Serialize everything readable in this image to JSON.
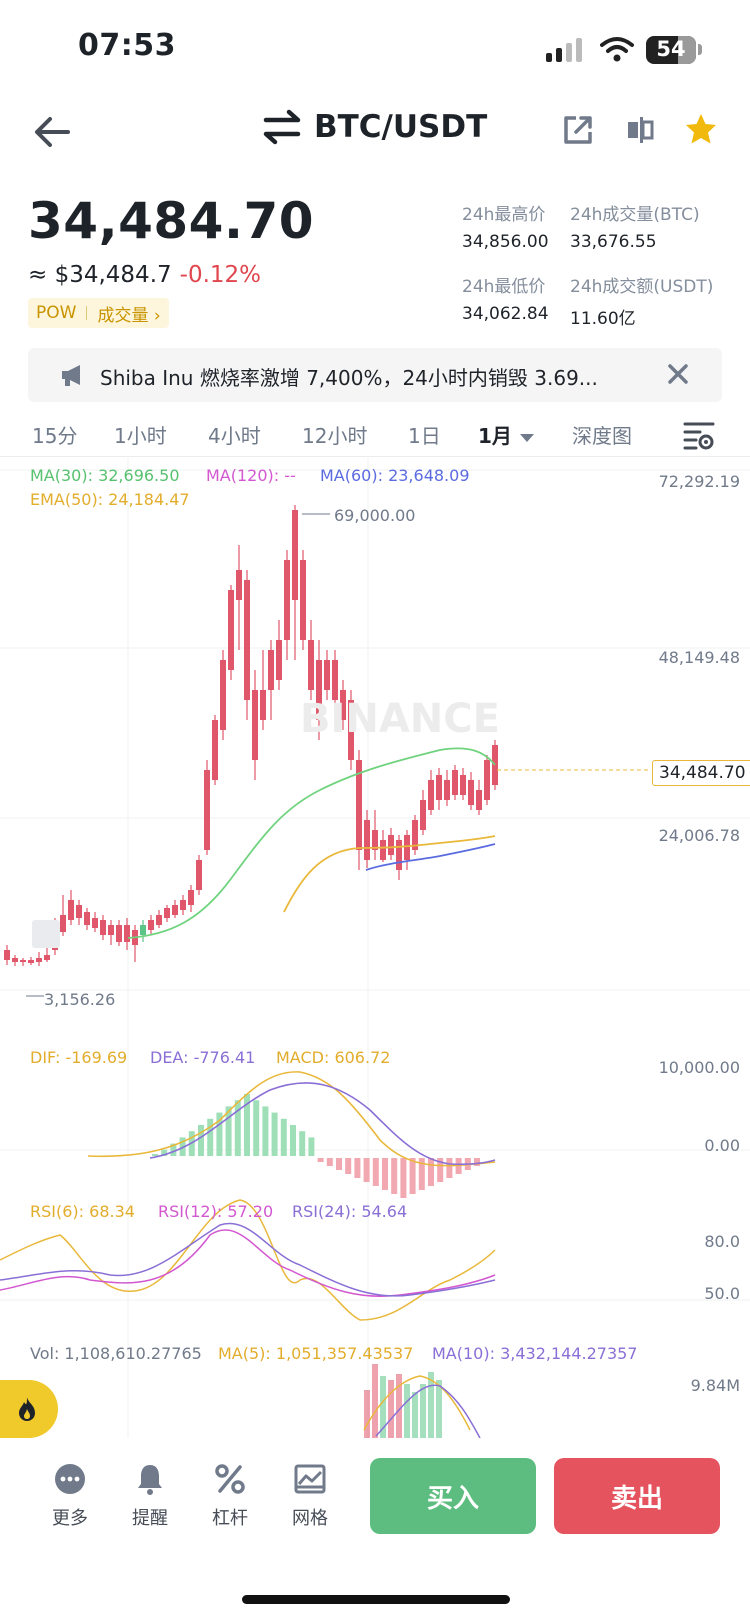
{
  "status_bar": {
    "time": "07:53",
    "battery": "54"
  },
  "header": {
    "title": "BTC/USDT"
  },
  "price": {
    "last": "34,484.70",
    "fiat": "≈ $34,484.7",
    "change": "-0.12%",
    "tag": "POW",
    "tag_link": "成交量 ›"
  },
  "stats": {
    "high_label": "24h最高价",
    "high_value": "34,856.00",
    "vol_btc_label": "24h成交量(BTC)",
    "vol_btc_value": "33,676.55",
    "low_label": "24h最低价",
    "low_value": "34,062.84",
    "vol_usdt_label": "24h成交额(USDT)",
    "vol_usdt_value": "11.60亿"
  },
  "news": {
    "text": "Shiba Inu 燃烧率激增 7,400%，24小时内销毁 3.69..."
  },
  "tabs": [
    "15分",
    "1小时",
    "4小时",
    "12小时",
    "1日",
    "1月",
    "深度图"
  ],
  "active_tab": "1月",
  "chart": {
    "indicators": {
      "ma30": "MA(30): 32,696.50",
      "ma120": "MA(120): --",
      "ma60": "MA(60): 23,648.09",
      "ema50": "EMA(50): 24,184.47"
    },
    "axis": {
      "top": "72,292.19",
      "mid": "48,149.48",
      "low": "24,006.78"
    },
    "current_price_tag": "34,484.70",
    "max_marker": "69,000.00",
    "min_marker": "3,156.26",
    "watermark": "BINANCE",
    "macd": {
      "dif": "DIF: -169.69",
      "dea": "DEA: -776.41",
      "macd": "MACD: 606.72",
      "axis_top": "10,000.00",
      "axis_zero": "0.00"
    },
    "rsi": {
      "rsi6": "RSI(6): 68.34",
      "rsi12": "RSI(12): 57.20",
      "rsi24": "RSI(24): 54.64",
      "axis_80": "80.0",
      "axis_50": "50.0"
    },
    "volume": {
      "vol": "Vol: 1,108,610.27765",
      "ma5": "MA(5): 1,051,357.43537",
      "ma10": "MA(10): 3,432,144.27357",
      "axis": "9.84M"
    },
    "colors": {
      "up": "#5dc487",
      "down": "#e0566a",
      "ma30": "#6fd37e",
      "ma120": "#d257d0",
      "ma60": "#5b6ce0",
      "ema50": "#e9b83a"
    }
  },
  "bottom": {
    "more": "更多",
    "alert": "提醒",
    "leverage": "杠杆",
    "grid": "网格",
    "buy": "买入",
    "sell": "卖出"
  }
}
